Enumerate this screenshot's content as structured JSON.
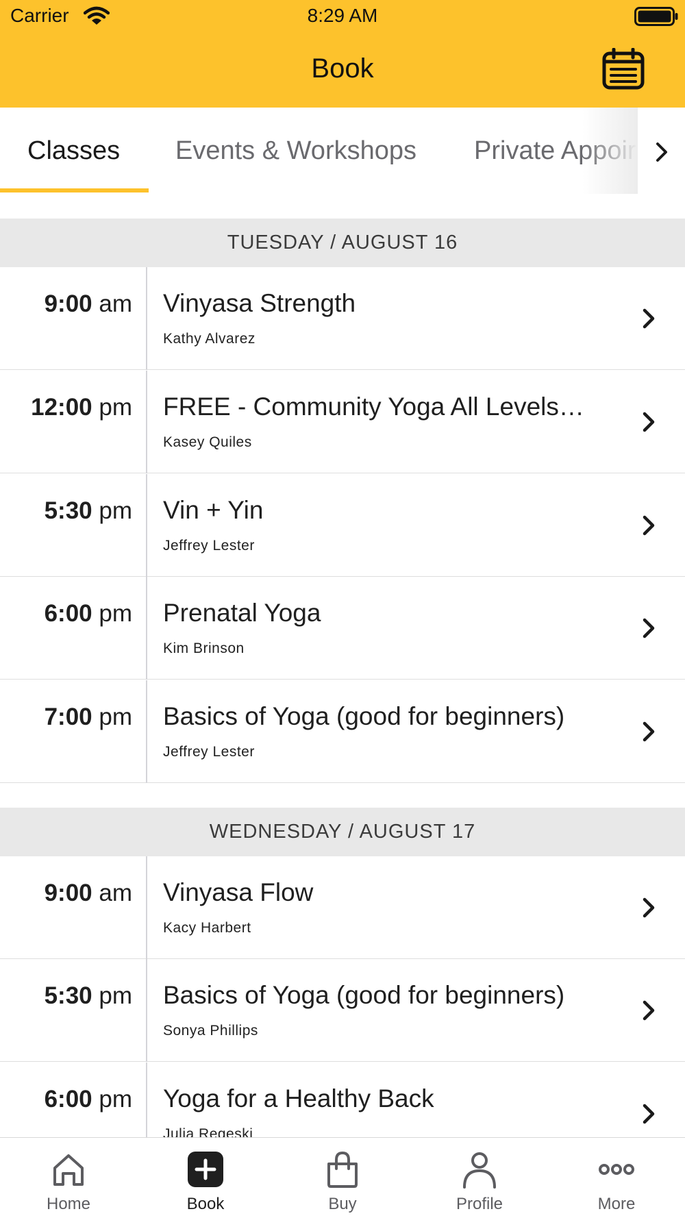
{
  "status_bar": {
    "carrier": "Carrier",
    "time": "8:29 AM"
  },
  "header": {
    "title": "Book",
    "calendar_icon": "calendar-icon"
  },
  "tabs": [
    {
      "label": "Classes",
      "active": true
    },
    {
      "label": "Events & Workshops",
      "active": false
    },
    {
      "label": "Private Appoir",
      "active": false
    }
  ],
  "days": [
    {
      "label": "TUESDAY / AUGUST 16",
      "classes": [
        {
          "time": "9:00",
          "ampm": "am",
          "name": "Vinyasa Strength",
          "instructor": "Kathy Alvarez"
        },
        {
          "time": "12:00",
          "ampm": "pm",
          "name": "FREE - Community Yoga All Levels…",
          "instructor": "Kasey Quiles"
        },
        {
          "time": "5:30",
          "ampm": "pm",
          "name": "Vin + Yin",
          "instructor": "Jeffrey Lester"
        },
        {
          "time": "6:00",
          "ampm": "pm",
          "name": "Prenatal Yoga",
          "instructor": "Kim Brinson"
        },
        {
          "time": "7:00",
          "ampm": "pm",
          "name": "Basics of Yoga (good for beginners)",
          "instructor": "Jeffrey Lester"
        }
      ]
    },
    {
      "label": "WEDNESDAY / AUGUST 17",
      "classes": [
        {
          "time": "9:00",
          "ampm": "am",
          "name": "Vinyasa Flow",
          "instructor": "Kacy Harbert"
        },
        {
          "time": "5:30",
          "ampm": "pm",
          "name": "Basics of Yoga (good for beginners)",
          "instructor": "Sonya Phillips"
        },
        {
          "time": "6:00",
          "ampm": "pm",
          "name": "Yoga for a Healthy Back",
          "instructor": "Julia Regeski"
        }
      ]
    }
  ],
  "bottom_nav": [
    {
      "label": "Home",
      "icon": "home-icon",
      "active": false
    },
    {
      "label": "Book",
      "icon": "plus-square-icon",
      "active": true
    },
    {
      "label": "Buy",
      "icon": "shopping-bag-icon",
      "active": false
    },
    {
      "label": "Profile",
      "icon": "person-icon",
      "active": false
    },
    {
      "label": "More",
      "icon": "more-dots-icon",
      "active": false
    }
  ],
  "colors": {
    "accent": "#FDC22C",
    "day_header_bg": "#e8e8e8",
    "text": "#1f1f1f",
    "muted": "#6a6a6e"
  }
}
